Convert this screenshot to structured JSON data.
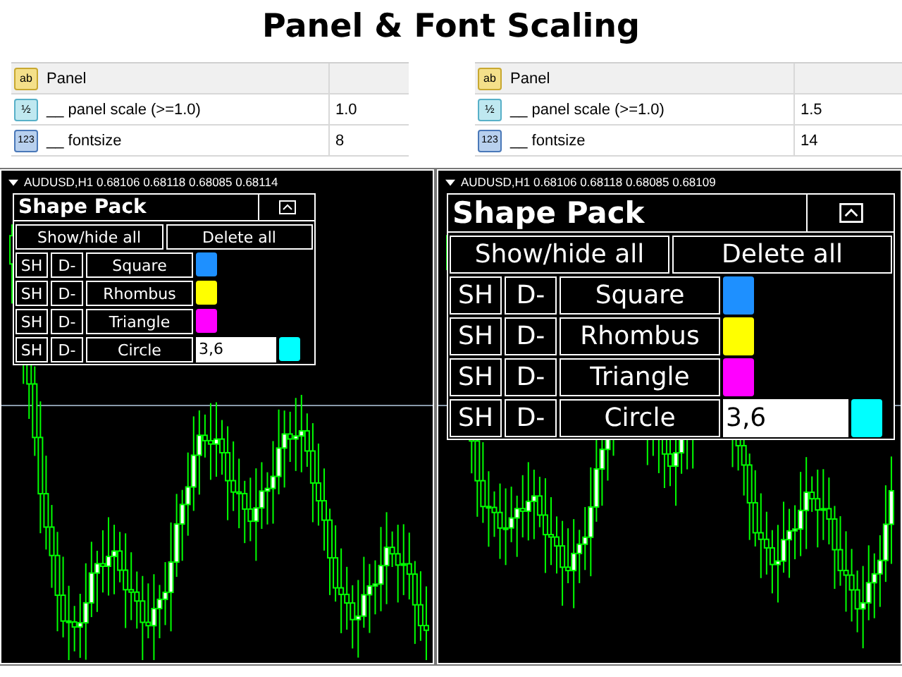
{
  "title": "Panel & Font Scaling",
  "examples": [
    {
      "kind": "normal",
      "properties": [
        {
          "kind": "text",
          "icon": "ab",
          "name": "Panel"
        },
        {
          "kind": "double",
          "icon": "½",
          "name": "__ panel scale (>=1.0)",
          "value": "1.0"
        },
        {
          "kind": "integer",
          "icon": "123",
          "name": "__ fontsize",
          "value": "8"
        }
      ],
      "chart": {
        "header": "AUDUSD,H1  0.68106 0.68118 0.68085 0.68114",
        "panel": {
          "title": "Shape Pack",
          "buttons": [
            "Show/hide all",
            "Delete all"
          ],
          "rows": [
            {
              "show": "SH",
              "delete": "D-",
              "name": "Square",
              "color": "#1e90ff"
            },
            {
              "show": "SH",
              "delete": "D-",
              "name": "Rhombus",
              "color": "#ffff00"
            },
            {
              "show": "SH",
              "delete": "D-",
              "name": "Triangle",
              "color": "#ff00ff"
            },
            {
              "show": "SH",
              "delete": "D-",
              "name": "Circle",
              "value": "3,6",
              "color": "#00ffff"
            }
          ]
        }
      }
    },
    {
      "kind": "large",
      "properties": [
        {
          "kind": "text",
          "icon": "ab",
          "name": "Panel"
        },
        {
          "kind": "double",
          "icon": "½",
          "name": "__ panel scale (>=1.0)",
          "value": "1.5"
        },
        {
          "kind": "integer",
          "icon": "123",
          "name": "__ fontsize",
          "value": "14"
        }
      ],
      "chart": {
        "header": "AUDUSD,H1  0.68106 0.68118 0.68085 0.68109",
        "panel": {
          "title": "Shape Pack",
          "buttons": [
            "Show/hide all",
            "Delete all"
          ],
          "rows": [
            {
              "show": "SH",
              "delete": "D-",
              "name": "Square",
              "color": "#1e90ff"
            },
            {
              "show": "SH",
              "delete": "D-",
              "name": "Rhombus",
              "color": "#ffff00"
            },
            {
              "show": "SH",
              "delete": "D-",
              "name": "Triangle",
              "color": "#ff00ff"
            },
            {
              "show": "SH",
              "delete": "D-",
              "name": "Circle",
              "value": "3,6",
              "color": "#00ffff"
            }
          ]
        }
      }
    }
  ]
}
